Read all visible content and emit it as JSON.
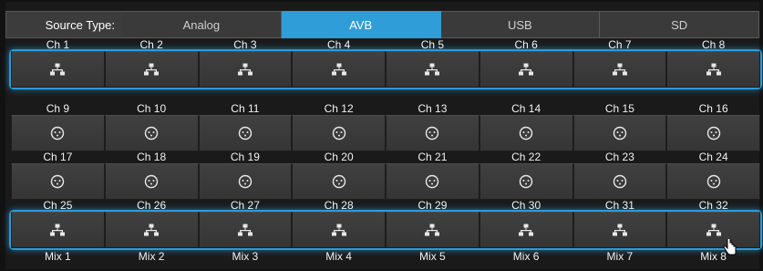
{
  "source": {
    "label": "Source Type:",
    "tabs": [
      "Analog",
      "AVB",
      "USB",
      "SD"
    ],
    "active": "AVB"
  },
  "colors": {
    "accent": "#2f9ed8",
    "background": "#1a1a1a",
    "button": "#3a3a3a"
  },
  "rows": [
    {
      "labels": [
        "Ch 1",
        "Ch 2",
        "Ch 3",
        "Ch 4",
        "Ch 5",
        "Ch 6",
        "Ch 7",
        "Ch 8"
      ],
      "icon": "network-icon",
      "highlighted": true
    },
    {
      "labels": [
        "Ch 9",
        "Ch 10",
        "Ch 11",
        "Ch 12",
        "Ch 13",
        "Ch 14",
        "Ch 15",
        "Ch 16"
      ],
      "icon": "xlr-input-icon",
      "highlighted": false
    },
    {
      "labels": [
        "Ch 17",
        "Ch 18",
        "Ch 19",
        "Ch 20",
        "Ch 21",
        "Ch 22",
        "Ch 23",
        "Ch 24"
      ],
      "icon": "xlr-input-icon",
      "highlighted": false
    },
    {
      "labels": [
        "Ch 25",
        "Ch 26",
        "Ch 27",
        "Ch 28",
        "Ch 29",
        "Ch 30",
        "Ch 31",
        "Ch 32"
      ],
      "icon": "network-icon",
      "highlighted": true
    }
  ],
  "bottom_labels": [
    "Mix 1",
    "Mix 2",
    "Mix 3",
    "Mix 4",
    "Mix 5",
    "Mix 6",
    "Mix 7",
    "Mix 8"
  ]
}
